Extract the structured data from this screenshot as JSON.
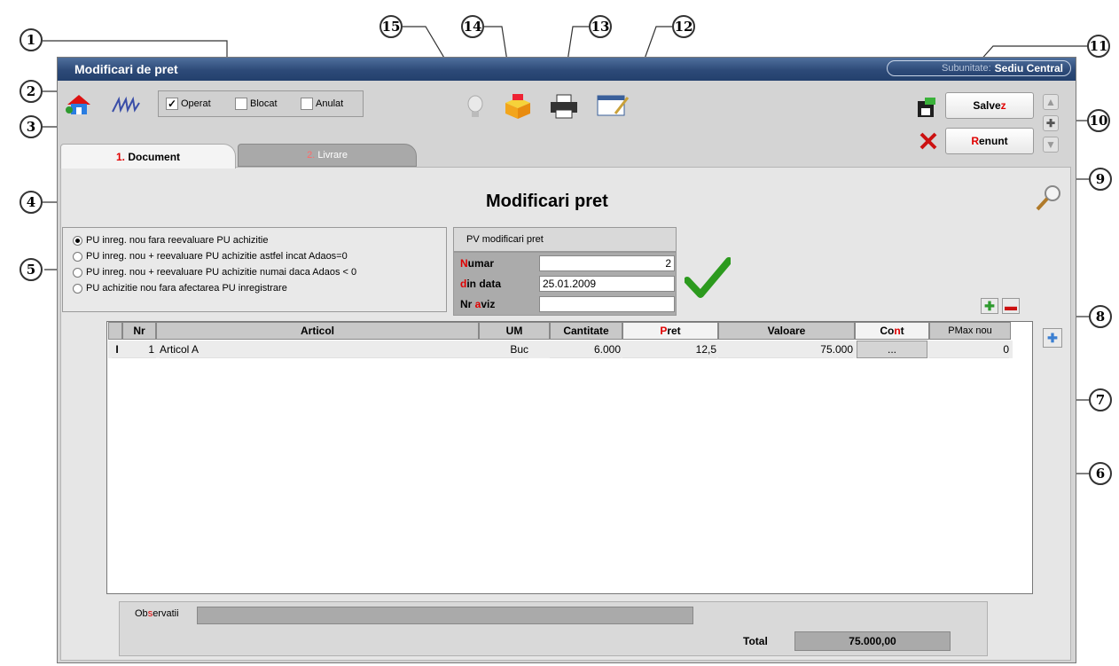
{
  "window": {
    "title": "Modificari de pret",
    "subunit_label": "Subunitate:",
    "subunit_value": "Sediu Central"
  },
  "status_checks": [
    {
      "label": "Operat",
      "checked": true
    },
    {
      "label": "Blocat",
      "checked": false
    },
    {
      "label": "Anulat",
      "checked": false
    }
  ],
  "actions": {
    "save_prefix": "Salve",
    "save_hotkey": "z",
    "cancel_hotkey": "R",
    "cancel_suffix": "enunt"
  },
  "tabs": [
    {
      "num": "1.",
      "label": "Document"
    },
    {
      "num": "2.",
      "label": "Livrare"
    }
  ],
  "heading": "Modificari pret",
  "options": [
    {
      "label": "PU inreg. nou  fara reevaluare PU achizitie",
      "selected": true
    },
    {
      "label": "PU inreg. nou  + reevaluare PU achizitie astfel incat Adaos=0",
      "selected": false
    },
    {
      "label": "PU inreg. nou  + reevaluare PU achizitie numai daca Adaos < 0",
      "selected": false
    },
    {
      "label": "PU achizitie nou fara afectarea PU inregistrare",
      "selected": false
    }
  ],
  "pv": {
    "title": "PV modificari pret",
    "numar_hot": "N",
    "numar_rest": "umar",
    "numar_value": "2",
    "data_hot": "d",
    "data_rest": "in data",
    "data_value": "25.01.2009",
    "aviz_pre": "Nr ",
    "aviz_hot": "a",
    "aviz_rest": "viz",
    "aviz_value": ""
  },
  "grid": {
    "columns": {
      "nr": "Nr",
      "articol": "Articol",
      "um": "UM",
      "cantitate": "Cantitate",
      "pret_hot": "P",
      "pret_rest": "ret",
      "valoare": "Valoare",
      "cont_pre": "Co",
      "cont_hot": "n",
      "cont_rest": "t",
      "pmax": "PMax nou"
    },
    "rows": [
      {
        "marker": "I",
        "nr": "1",
        "articol": "Articol A",
        "um": "Buc",
        "cantitate": "6.000",
        "pret": "12,5",
        "valoare": "75.000",
        "cont": "...",
        "pmax": "0"
      }
    ]
  },
  "footer": {
    "obs_pre": "Ob",
    "obs_hot": "s",
    "obs_rest": "ervatii",
    "total_label": "Total",
    "total_value": "75.000,00"
  },
  "callouts": [
    "1",
    "2",
    "3",
    "4",
    "5",
    "6",
    "7",
    "8",
    "9",
    "10",
    "11",
    "12",
    "13",
    "14",
    "15"
  ]
}
